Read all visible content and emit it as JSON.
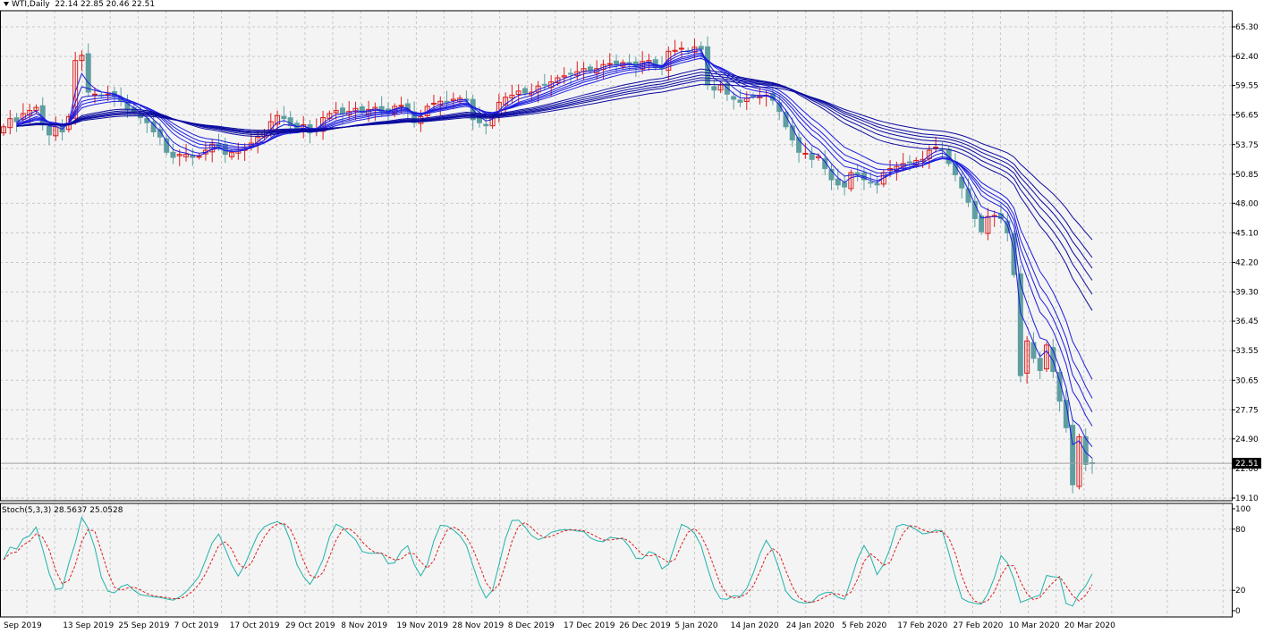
{
  "header": {
    "symbol": "WTI,Daily",
    "ohlc": "22.14 22.85 20.46 22.51"
  },
  "indicator": {
    "label": "Stoch(5,3,3) 28.5637 25.0528"
  },
  "colors": {
    "background": "#f4f4f4",
    "grid": "#c8c8c8",
    "bull_candle": "#dc1e1e",
    "bear_candle": "#5f9ea0",
    "ma_lines": "#0a0aa0",
    "stoch_main": "#20b2aa",
    "stoch_signal": "#dc1e1e",
    "price_tag_bg": "#000000",
    "price_tag_fg": "#ffffff"
  },
  "chart_data": [
    {
      "type": "candlestick",
      "price_axis": [
        "65.30",
        "62.40",
        "59.55",
        "56.65",
        "53.75",
        "50.85",
        "48.00",
        "45.10",
        "42.20",
        "39.30",
        "36.45",
        "33.55",
        "30.65",
        "27.75",
        "24.90",
        "22.00",
        "19.10"
      ],
      "date_axis": [
        "Sep 2019",
        "13 Sep 2019",
        "25 Sep 2019",
        "7 Oct 2019",
        "17 Oct 2019",
        "29 Oct 2019",
        "8 Nov 2019",
        "19 Nov 2019",
        "28 Nov 2019",
        "8 Dec 2019",
        "17 Dec 2019",
        "26 Dec 2019",
        "5 Jan 2020",
        "14 Jan 2020",
        "24 Jan 2020",
        "5 Feb 2020",
        "17 Feb 2020",
        "27 Feb 2020",
        "10 Mar 2020",
        "20 Mar 2020"
      ],
      "last_price": "22.51",
      "ylim": [
        19.1,
        65.3
      ],
      "closes": [
        55.5,
        56.3,
        56.0,
        56.8,
        57.1,
        57.4,
        55.8,
        54.7,
        55.5,
        55.0,
        56.5,
        62.0,
        62.5,
        58.9,
        58.7,
        58.6,
        58.7,
        58.5,
        58.0,
        57.2,
        57.0,
        56.4,
        55.9,
        55.0,
        54.5,
        53.0,
        52.5,
        52.8,
        52.8,
        52.5,
        52.6,
        53.2,
        53.8,
        53.6,
        52.8,
        53.0,
        53.1,
        53.4,
        53.9,
        54.5,
        55.0,
        56.0,
        56.6,
        56.3,
        55.6,
        55.2,
        55.7,
        54.9,
        55.3,
        56.4,
        56.8,
        57.1,
        56.8,
        57.0,
        57.3,
        56.9,
        57.2,
        57.4,
        57.0,
        56.9,
        57.5,
        57.6,
        57.2,
        55.9,
        56.5,
        57.5,
        57.8,
        58.0,
        57.9,
        58.2,
        58.3,
        58.1,
        56.2,
        55.9,
        55.6,
        56.4,
        57.9,
        58.4,
        58.6,
        59.0,
        58.8,
        58.9,
        59.5,
        59.6,
        59.9,
        60.3,
        60.5,
        60.7,
        60.9,
        61.2,
        61.0,
        61.2,
        61.6,
        61.7,
        61.6,
        61.8,
        61.7,
        61.4,
        61.9,
        62.0,
        61.3,
        61.2,
        62.9,
        63.0,
        63.2,
        62.9,
        63.3,
        63.1,
        59.6,
        59.1,
        59.6,
        58.7,
        58.2,
        57.9,
        58.3,
        58.5,
        58.5,
        58.6,
        58.1,
        57.0,
        55.5,
        54.2,
        53.0,
        52.9,
        52.3,
        52.6,
        51.4,
        50.3,
        49.8,
        49.6,
        51.0,
        50.8,
        50.3,
        50.0,
        49.8,
        51.0,
        51.4,
        51.6,
        51.9,
        52.0,
        52.2,
        52.3,
        53.2,
        53.5,
        53.3,
        51.9,
        50.8,
        49.5,
        48.1,
        46.5,
        45.2,
        46.7,
        46.8,
        46.5,
        45.1,
        41.0,
        31.1,
        34.5,
        32.8,
        31.6,
        34.1,
        31.5,
        28.6,
        26.0,
        20.4,
        25.1,
        22.4,
        22.5
      ]
    },
    {
      "type": "line",
      "title": "Stoch(5,3,3) 28.5637 25.0528",
      "y_ticks": [
        "100",
        "80",
        "20",
        "0"
      ],
      "ylim": [
        0,
        100
      ]
    }
  ]
}
